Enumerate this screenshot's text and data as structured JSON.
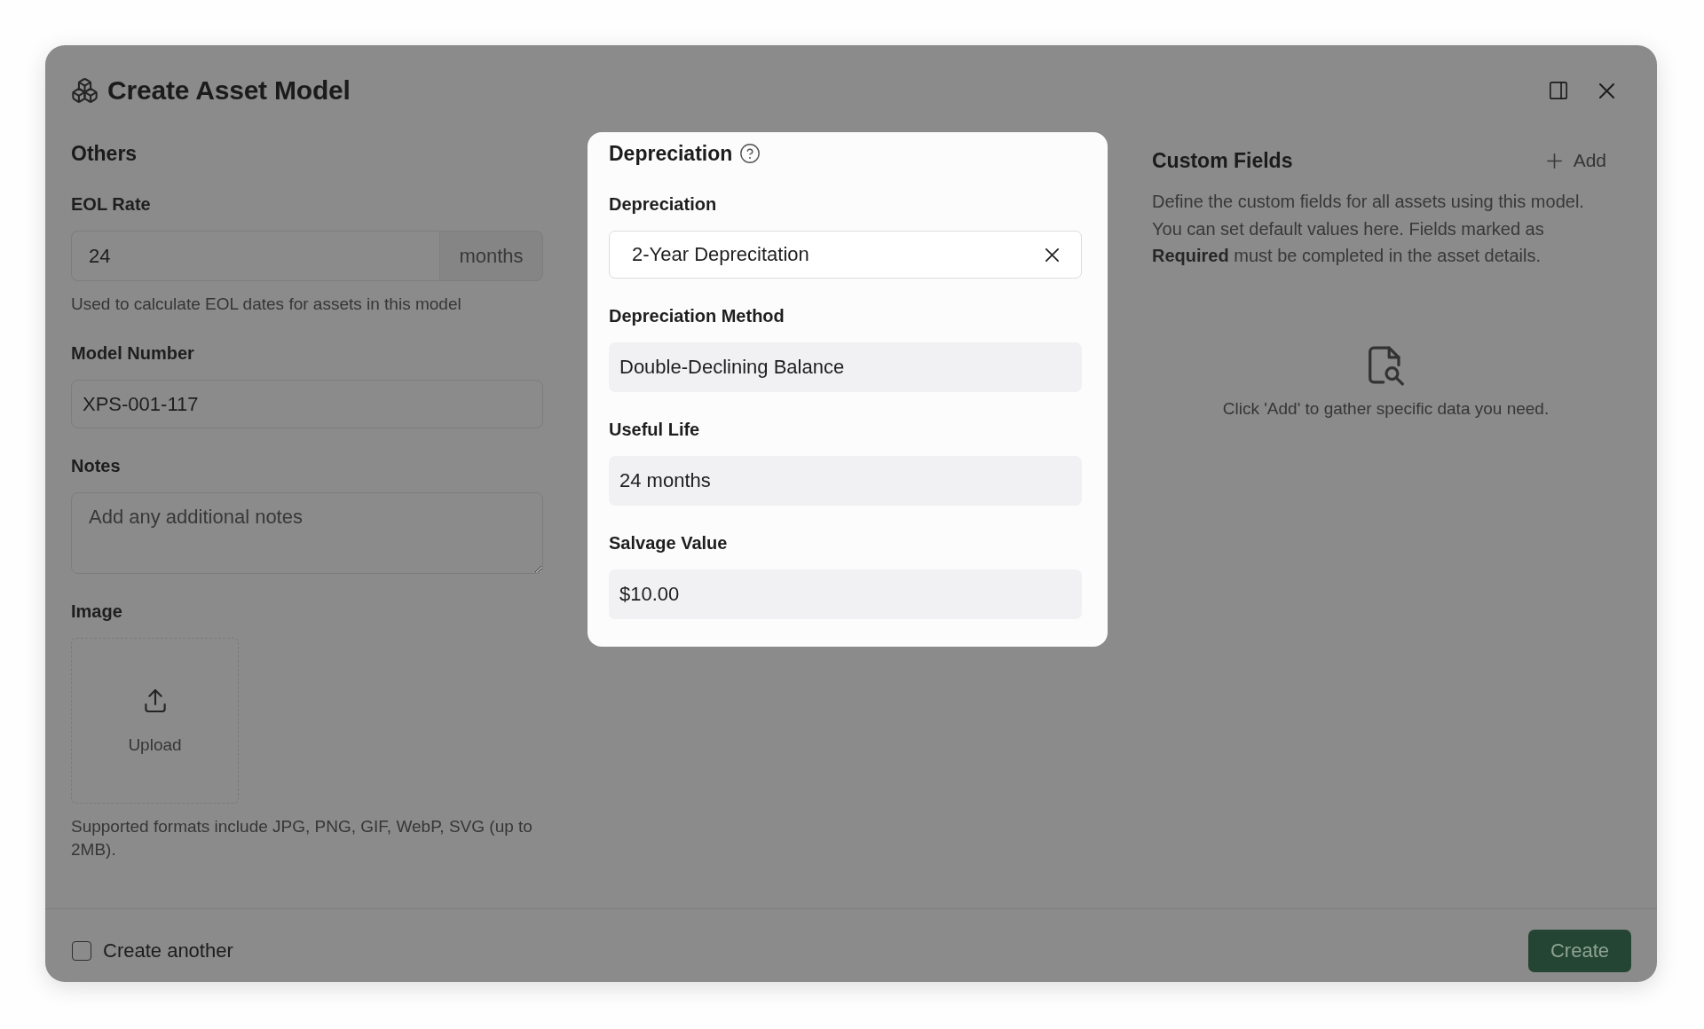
{
  "dialog": {
    "title": "Create Asset Model"
  },
  "others": {
    "heading": "Others",
    "fields": [
      {
        "kind": "unit_input",
        "label": "EOL Rate",
        "value": "24",
        "unit": "months",
        "help": "Used to calculate EOL dates for assets in this model"
      },
      {
        "kind": "text_input",
        "label": "Model Number",
        "value": "XPS-001-117"
      },
      {
        "kind": "textarea",
        "label": "Notes",
        "placeholder": "Add any additional notes"
      },
      {
        "kind": "upload",
        "label": "Image",
        "button_label": "Upload",
        "help": "Supported formats include JPG, PNG, GIF, WebP, SVG (up to 2MB)."
      }
    ]
  },
  "depreciation": {
    "heading": "Depreciation",
    "fields": [
      {
        "kind": "select",
        "label": "Depreciation",
        "value": "2-Year Deprecitation"
      },
      {
        "kind": "readonly",
        "label": "Depreciation Method",
        "value": "Double-Declining Balance"
      },
      {
        "kind": "readonly",
        "label": "Useful Life",
        "value": "24 months"
      },
      {
        "kind": "readonly",
        "label": "Salvage Value",
        "value": "$10.00"
      }
    ]
  },
  "custom_fields": {
    "heading": "Custom Fields",
    "add_button": "Add",
    "description": "Define the custom fields for all assets using this model. You can set default values here. Fields marked as **Required** must be completed in the asset details.",
    "empty_message": "Click 'Add' to gather specific data you need."
  },
  "footer": {
    "create_another": {
      "label": "Create another",
      "checked": false
    },
    "create_button": "Create"
  }
}
